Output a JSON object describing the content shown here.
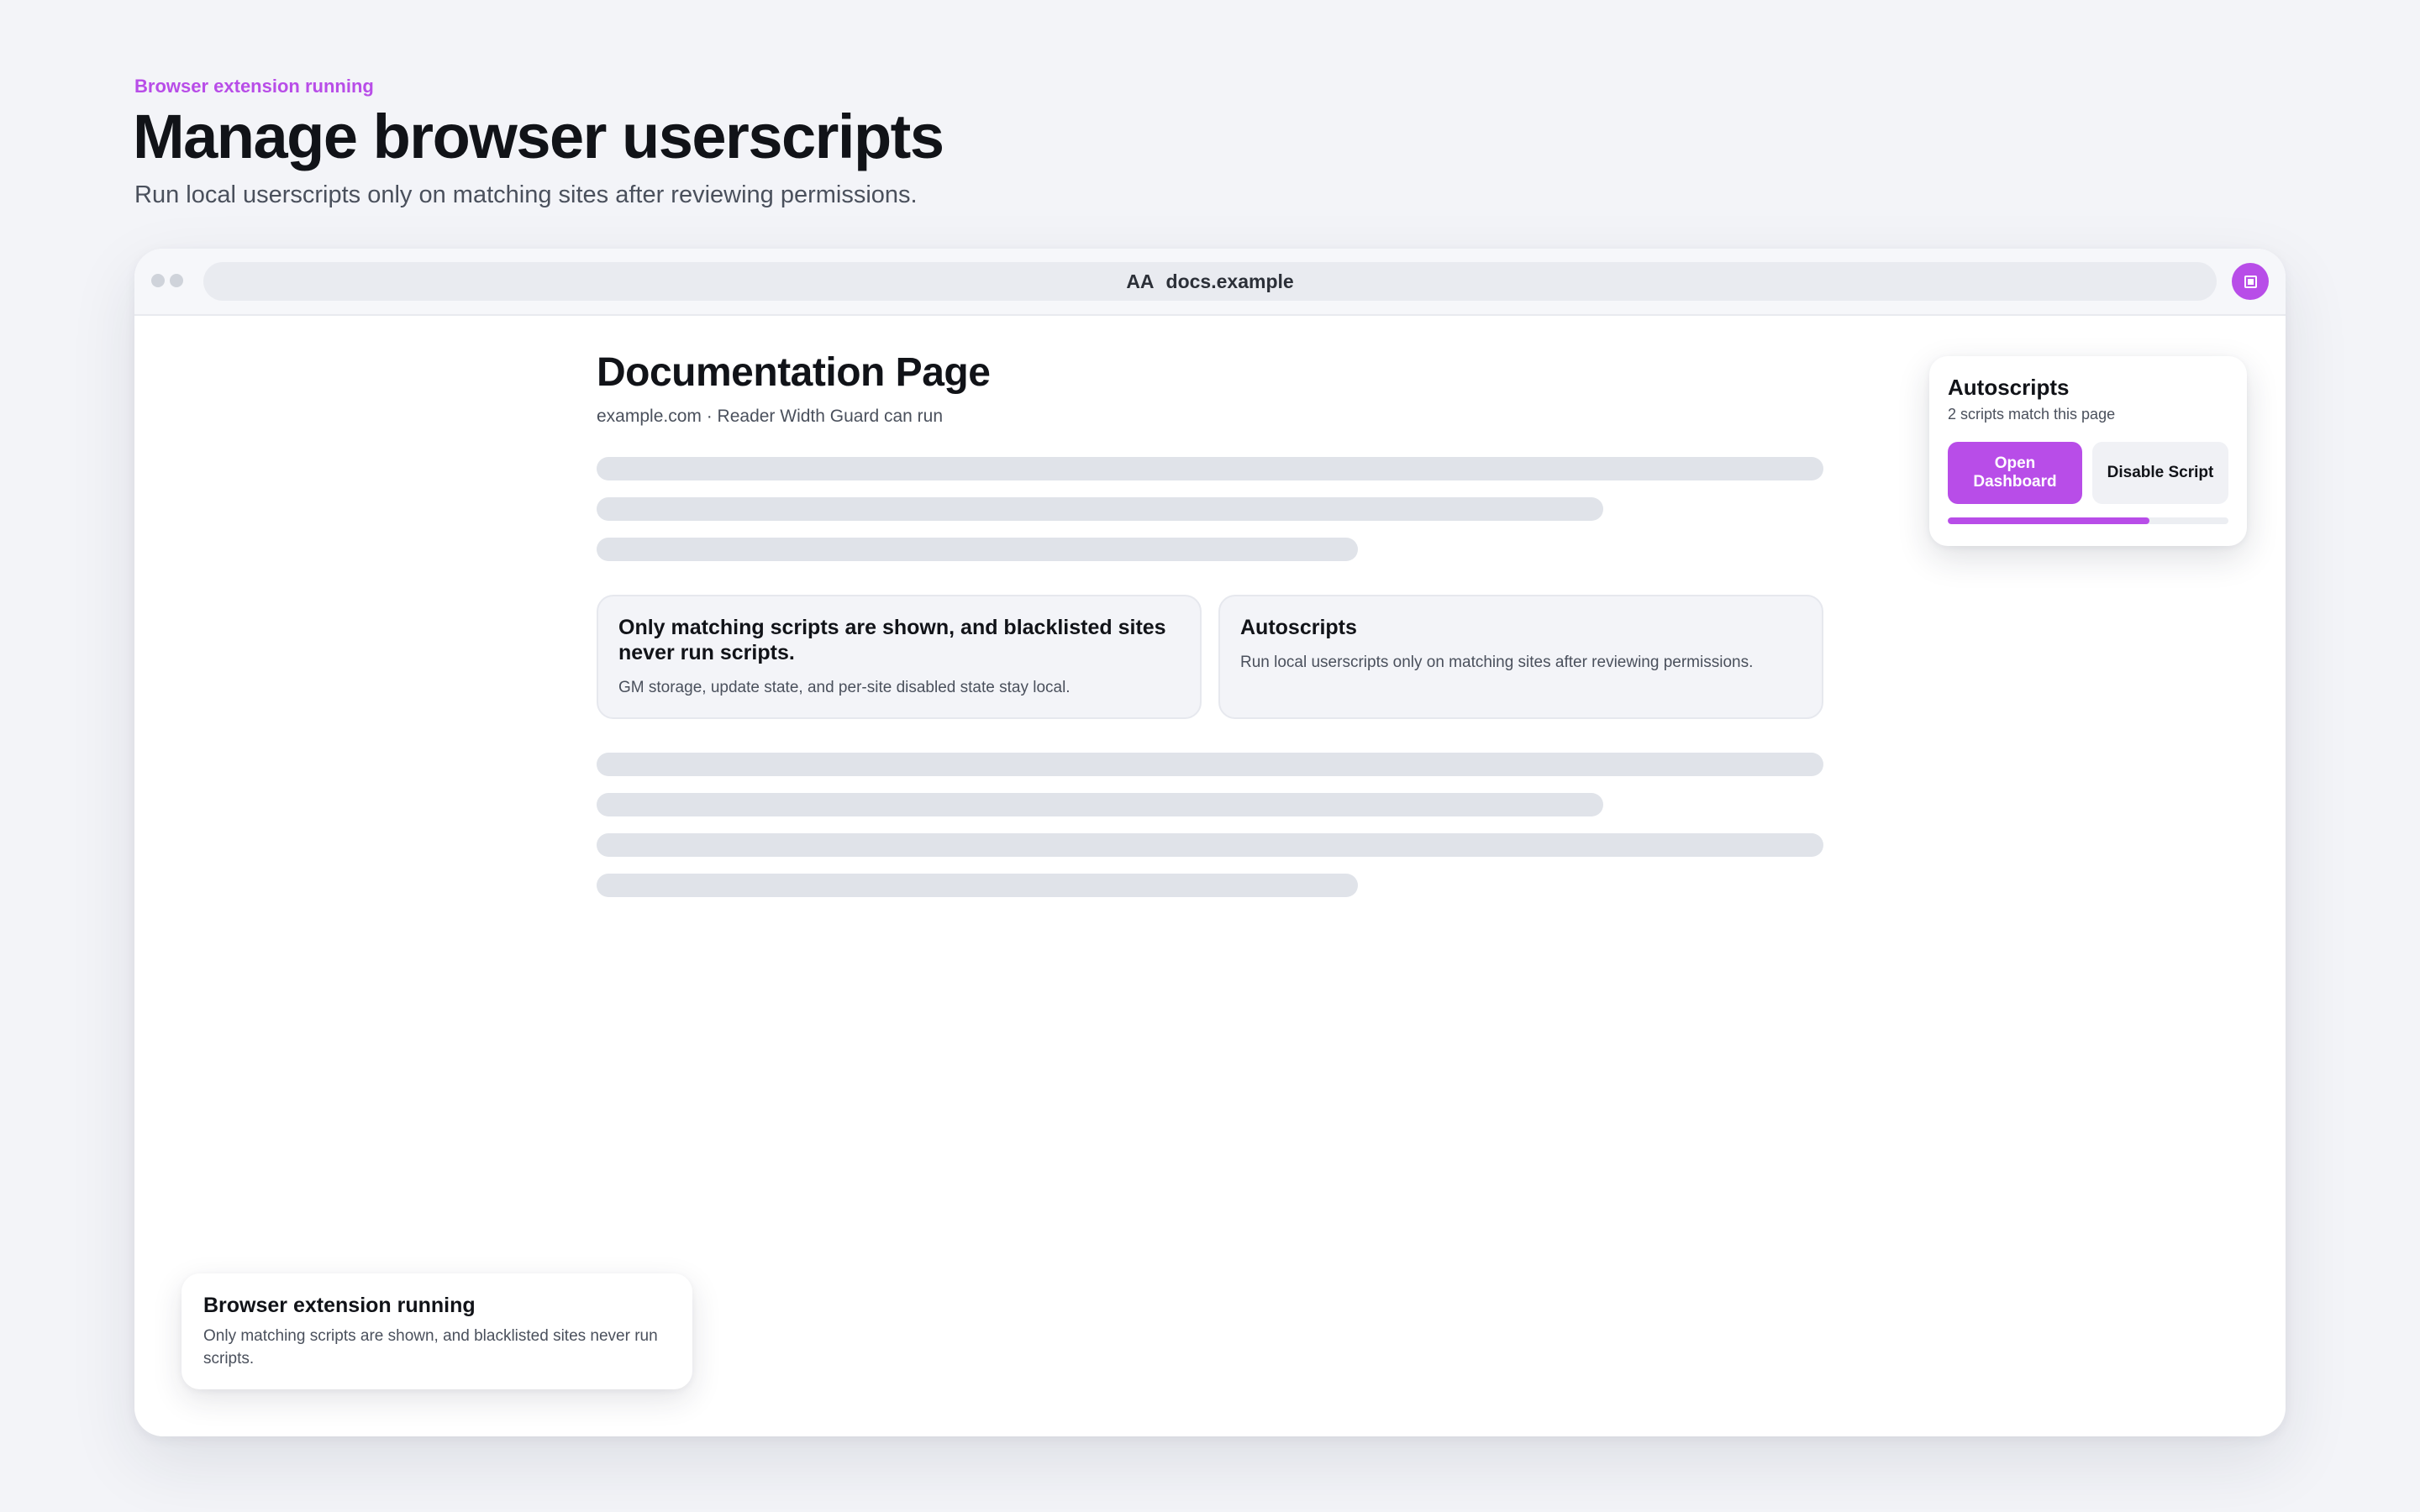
{
  "header": {
    "eyebrow": "Browser extension running",
    "title": "Manage browser userscripts",
    "subtitle": "Run local userscripts only on matching sites after reviewing permissions."
  },
  "browser": {
    "reader_mode_label": "AA",
    "url": "docs.example",
    "extension_icon": "userscript-extension-icon"
  },
  "page": {
    "title": "Documentation Page",
    "meta": "example.com · Reader Width Guard can run",
    "cards": [
      {
        "title": "Only matching scripts are shown, and blacklisted sites never run scripts.",
        "body": "GM storage, update state, and per-site disabled state stay local."
      },
      {
        "title": "Autoscripts",
        "body": "Run local userscripts only on matching sites after reviewing permissions."
      }
    ]
  },
  "popup": {
    "title": "Autoscripts",
    "subtitle": "2 scripts match this page",
    "primary_button": "Open Dashboard",
    "secondary_button": "Disable Script",
    "progress_fraction": 0.72
  },
  "toast": {
    "title": "Browser extension running",
    "body": "Only matching scripts are shown, and blacklisted sites never run scripts."
  },
  "colors": {
    "accent": "#b84de8",
    "background": "#f3f4f8",
    "placeholder": "#e0e3e9"
  }
}
